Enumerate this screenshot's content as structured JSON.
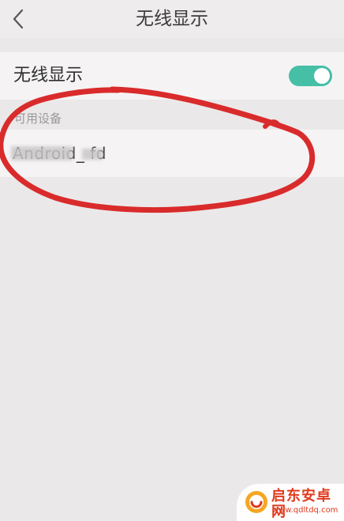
{
  "navbar": {
    "title": "无线显示",
    "back_icon": "chevron-left-icon"
  },
  "wireless_display": {
    "label": "无线显示",
    "enabled": true,
    "switch_color": "#45bfa6"
  },
  "devices_section": {
    "header": "可用设备",
    "devices": [
      {
        "name": "Android_   fd"
      }
    ]
  },
  "annotation": {
    "color": "#d92b2b"
  },
  "watermark": {
    "name": "启东安卓网",
    "url": "www.qdltdq.com",
    "color": "#e03a1e"
  }
}
